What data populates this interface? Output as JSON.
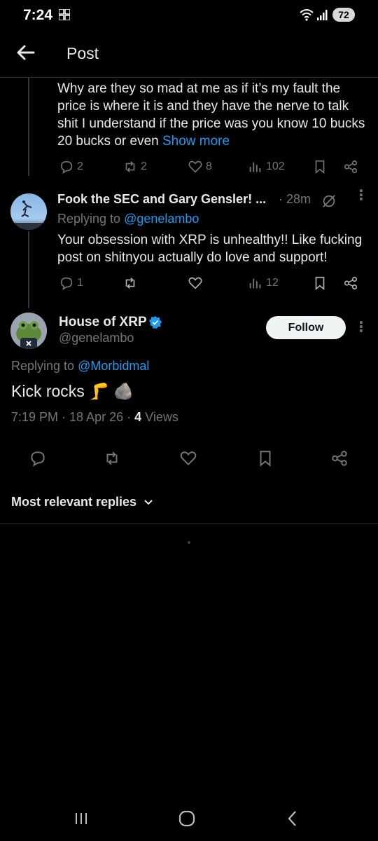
{
  "status": {
    "time": "7:24",
    "battery": "72"
  },
  "header": {
    "title": "Post"
  },
  "prev_reply": {
    "text": "Why are they so mad at me as if it’s my fault the price is where it is and they have the nerve to talk shit I understand if the price was you know 10 bucks 20 bucks or even",
    "show_more": "Show more",
    "stats": {
      "replies": "2",
      "reposts": "2",
      "likes": "8",
      "views": "102"
    }
  },
  "reply2": {
    "name": "Fook the SEC and Gary Gensler! ...",
    "time": "· 28m",
    "replying_prefix": "Replying to",
    "replying_to": "@genelambo",
    "text": "Your obsession with XRP is unhealthy!! Like fucking post on shitnyou actually do love and support!",
    "stats": {
      "replies": "1",
      "views": "12"
    }
  },
  "main_post": {
    "name": "House of XRP",
    "handle": "@genelambo",
    "follow": "Follow",
    "replying_prefix": "Replying to",
    "replying_to": "@Morbidmal",
    "text": "Kick rocks 🦵 🪨",
    "meta": "7:19 PM · 18 Apr 26 ·",
    "views_count": "4",
    "views_label": "Views"
  },
  "sort": {
    "label": "Most relevant replies"
  },
  "colors": {
    "accent": "#1d9bf0",
    "background": "#000000",
    "muted": "#71767b"
  }
}
